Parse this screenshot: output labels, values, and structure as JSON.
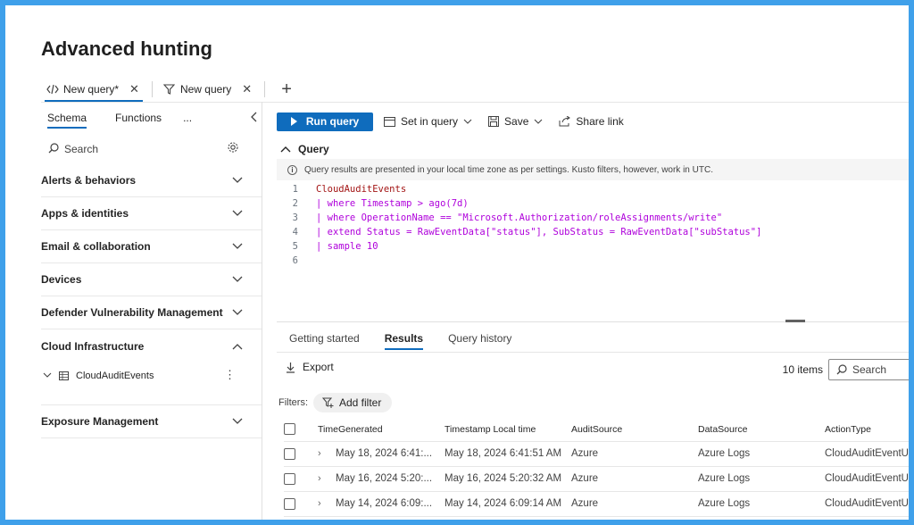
{
  "page": {
    "title": "Advanced hunting"
  },
  "query_tabs": [
    {
      "label": "New query*",
      "active": true
    },
    {
      "label": "New query",
      "active": false
    }
  ],
  "left_pane": {
    "tabs": [
      "Schema",
      "Functions",
      "..."
    ],
    "search_label": "Search",
    "sections": [
      {
        "label": "Alerts & behaviors",
        "expanded": false
      },
      {
        "label": "Apps & identities",
        "expanded": false
      },
      {
        "label": "Email & collaboration",
        "expanded": false
      },
      {
        "label": "Devices",
        "expanded": false
      },
      {
        "label": "Defender Vulnerability Management",
        "expanded": false
      },
      {
        "label": "Cloud Infrastructure",
        "expanded": true,
        "items": [
          "CloudAuditEvents"
        ]
      },
      {
        "label": "Exposure Management",
        "expanded": false
      }
    ]
  },
  "toolbar": {
    "run_label": "Run query",
    "set_in_query_label": "Set in query",
    "save_label": "Save",
    "share_label": "Share link"
  },
  "query": {
    "heading": "Query",
    "info": "Query results are presented in your local time zone as per settings. Kusto filters, however, work in UTC.",
    "lines": [
      "CloudAuditEvents",
      "| where Timestamp > ago(7d)",
      "| where OperationName == \"Microsoft.Authorization/roleAssignments/write\"",
      "| extend Status = RawEventData[\"status\"], SubStatus = RawEventData[\"subStatus\"]",
      "| sample 10",
      ""
    ]
  },
  "results": {
    "tabs": [
      "Getting started",
      "Results",
      "Query history"
    ],
    "active_tab": "Results",
    "export_label": "Export",
    "count_label": "10 items",
    "search_label": "Search",
    "filters_label": "Filters:",
    "add_filter_label": "Add filter",
    "columns": [
      "TimeGenerated",
      "Timestamp Local time",
      "AuditSource",
      "DataSource",
      "ActionType"
    ],
    "rows": [
      [
        "May 18, 2024 6:41:...",
        "May 18, 2024 6:41:51 AM",
        "Azure",
        "Azure Logs",
        "CloudAuditEventUp"
      ],
      [
        "May 16, 2024 5:20:...",
        "May 16, 2024 5:20:32 AM",
        "Azure",
        "Azure Logs",
        "CloudAuditEventUp"
      ],
      [
        "May 14, 2024 6:09:...",
        "May 14, 2024 6:09:14 AM",
        "Azure",
        "Azure Logs",
        "CloudAuditEventUp"
      ]
    ]
  },
  "colors": {
    "accent": "#0f6cbd",
    "frame": "#3fa0ea"
  }
}
